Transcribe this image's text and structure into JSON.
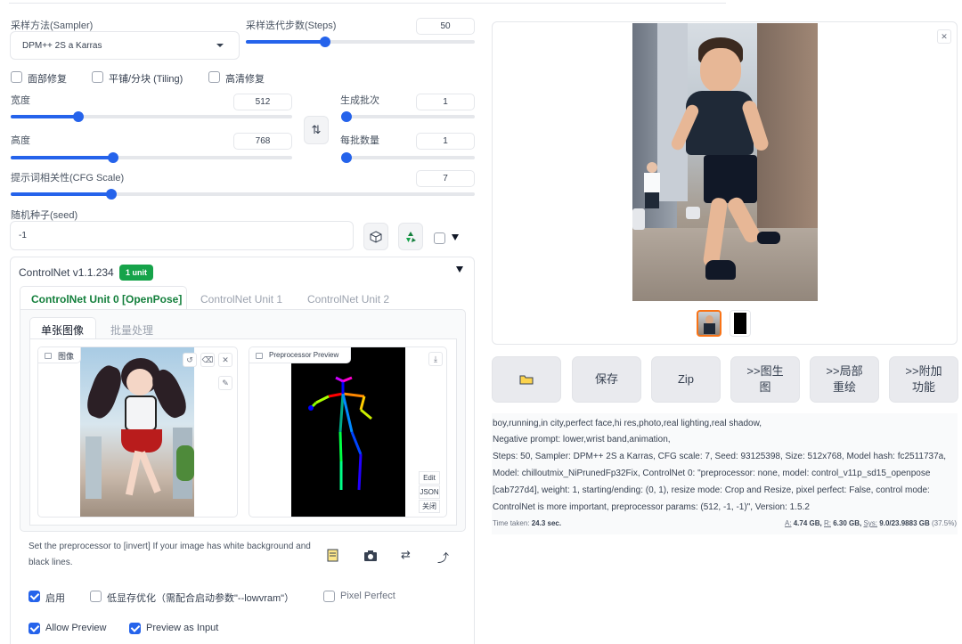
{
  "sampler": {
    "label": "采样方法(Sampler)",
    "value": "DPM++ 2S a Karras"
  },
  "steps": {
    "label": "采样迭代步数(Steps)",
    "value": "50",
    "level": 0.34
  },
  "options": {
    "face_restore": "面部修复",
    "tiling": "平铺/分块 (Tiling)",
    "hires_fix": "高清修复"
  },
  "width": {
    "label": "宽度",
    "value": "512",
    "level": 0.23
  },
  "height": {
    "label": "高度",
    "value": "768",
    "level": 0.36
  },
  "batch_count": {
    "label": "生成批次",
    "value": "1",
    "level": 0.0
  },
  "batch_size": {
    "label": "每批数量",
    "value": "1",
    "level": 0.0
  },
  "swap_icon": "swap-icon",
  "cfg": {
    "label": "提示词相关性(CFG Scale)",
    "value": "7",
    "level": 0.21
  },
  "seed": {
    "label": "随机种子(seed)",
    "value": "-1"
  },
  "controlnet": {
    "title": "ControlNet v1.1.234",
    "badge": "1 unit",
    "tabs": [
      "ControlNet Unit 0 [OpenPose]",
      "ControlNet Unit 1",
      "ControlNet Unit 2"
    ],
    "subtabs": [
      "单张图像",
      "批量处理"
    ],
    "image_label": "图像",
    "preview_label": "Preprocessor Preview",
    "pose_buttons": [
      "Edit",
      "JSON",
      "关闭"
    ],
    "hint": "Set the preprocessor to [invert] If your image has white background and black lines.",
    "enable": "启用",
    "lowvram": "低显存优化（需配合启动参数\"--lowvram\"）",
    "pixel_perfect": "Pixel Perfect",
    "allow_preview": "Allow Preview",
    "preview_as_input": "Preview as Input"
  },
  "output": {
    "buttons": [
      "保存",
      "Zip",
      ">>图生图",
      ">>局部重绘",
      ">>附加功能"
    ],
    "prompt": "boy,running,in city,perfect face,hi res,photo,real lighting,real shadow,",
    "negative": "Negative prompt: lower,wrist band,animation,",
    "params": "Steps: 50, Sampler: DPM++ 2S a Karras, CFG scale: 7, Seed: 93125398, Size: 512x768, Model hash: fc2511737a, Model: chilloutmix_NiPrunedFp32Fix, ControlNet 0: \"preprocessor: none, model: control_v11p_sd15_openpose [cab727d4], weight: 1, starting/ending: (0, 1), resize mode: Crop and Resize, pixel perfect: False, control mode: ControlNet is more important, preprocessor params: (512, -1, -1)\", Version: 1.5.2",
    "time_label": "Time taken:",
    "time_value": "24.3 sec.",
    "mem_a_label": "A:",
    "mem_a": "4.74 GB,",
    "mem_r_label": "R:",
    "mem_r": "6.30 GB,",
    "mem_sys_label": "Sys:",
    "mem_sys": "9.0/23.9883 GB",
    "mem_pct": "(37.5%)"
  },
  "colors": {
    "accent": "#2563eb",
    "badge": "#16a34a",
    "tab_active": "#15803d",
    "thumb_border": "#f97316"
  }
}
